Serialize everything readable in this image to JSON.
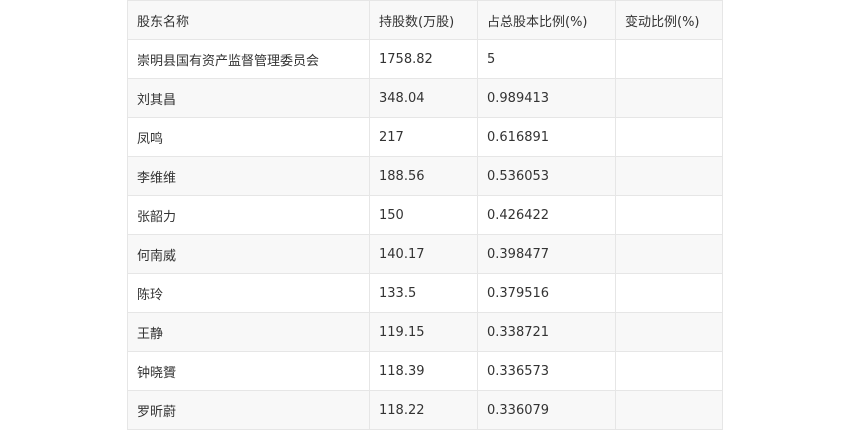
{
  "table": {
    "headers": [
      "股东名称",
      "持股数(万股)",
      "占总股本比例(%)",
      "变动比例(%)"
    ],
    "rows": [
      [
        "崇明县国有资产监督管理委员会",
        "1758.82",
        "5",
        ""
      ],
      [
        "刘其昌",
        "348.04",
        "0.989413",
        ""
      ],
      [
        "凤鸣",
        "217",
        "0.616891",
        ""
      ],
      [
        "李维维",
        "188.56",
        "0.536053",
        ""
      ],
      [
        "张韶力",
        "150",
        "0.426422",
        ""
      ],
      [
        "何南威",
        "140.17",
        "0.398477",
        ""
      ],
      [
        "陈玲",
        "133.5",
        "0.379516",
        ""
      ],
      [
        "王静",
        "119.15",
        "0.338721",
        ""
      ],
      [
        "钟晓贇",
        "118.39",
        "0.336573",
        ""
      ],
      [
        "罗昕蔚",
        "118.22",
        "0.336079",
        ""
      ]
    ]
  }
}
